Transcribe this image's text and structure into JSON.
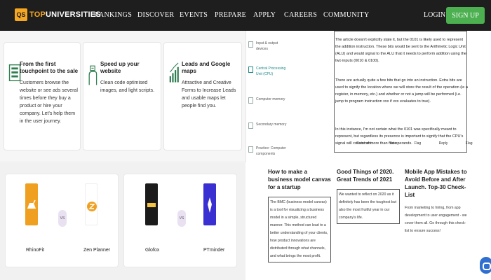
{
  "nav": {
    "logo_badge": "QS",
    "logo_top": "TOP",
    "logo_rest": "UNIVERSITIES",
    "items": [
      "RANKINGS",
      "DISCOVER",
      "EVENTS",
      "PREPARE",
      "APPLY",
      "CAREERS",
      "COMMUNITY"
    ],
    "login": "LOGIN",
    "signup": "SIGN UP"
  },
  "features": [
    {
      "title": "From the first touchpoint to the sale",
      "text": "Customers browse the website or see ads several times before they buy a product or hire your company. Let's help them in the user journey.",
      "icon": "touchpoint-icon"
    },
    {
      "title": "Speed up your website",
      "text": "Clean code optimised images, and light scripts.",
      "icon": "speed-hand-icon"
    },
    {
      "title": "Leads and Google maps",
      "text": "Attractive and Creative Forms to Increase Leads and usable maps let people find you.",
      "icon": "growth-chart-icon"
    }
  ],
  "comparisons": [
    {
      "left": "RhinoFit",
      "right": "Zen Planner",
      "vs": "VS"
    },
    {
      "left": "Glofox",
      "right": "PTminder",
      "vs": "VS"
    }
  ],
  "sidebar": {
    "items": [
      {
        "label": "Input & output devices",
        "active": false
      },
      {
        "label": "Central Processing Unit (CPU)",
        "active": true
      },
      {
        "label": "Computer memory",
        "active": false
      },
      {
        "label": "Secondary memory",
        "active": false
      },
      {
        "label": "Practice: Computer components",
        "active": false
      }
    ]
  },
  "doc": {
    "p1": "The article doesn't explicitly state it, but the 0101 is likely used to represent the addition instruction. These bits would be sent to the Arithmetic Logic Unit (ALU) and would signal to the ALU that it needs to perform addition using the two inputs (0010 & 0100).",
    "p2": "There are actually quite a few bits that go into an instruction. Extra bits are used to signify the location where we will store the result of the operation (ie a register, in memory, etc.) and whether or not a jump will be performed (i.e. jump to program instruction xxx if xxx evaluates to true).",
    "p3": "In this instance, I'm not certain what the 0101 was specifically meant to represent, but regardless its presence is important to signify that the CPU's signal will consist of more than the operands.",
    "actions": [
      "Comment",
      "Vote",
      "Flag",
      "Reply",
      "Flag"
    ]
  },
  "articles": [
    {
      "title": "How to make a business model canvas for a startup",
      "text": "The BMC (business model canvas) is a tool for visualizing a business model in a simple, structured manner. This method can lead to a better understanding of your clients, how product innovations are distributed through what channels, and what brings the most profit."
    },
    {
      "title": "Good Things of 2020. Great Trends of 2021",
      "text": "We wanted to reflect on 2020 as it definitely has been the toughest but also the most fruitful year in our company's life."
    },
    {
      "title": "Mobile App Mistakes to Avoid Before and After Launch. Top-30 Check-List",
      "text": "From marketing to hiring, from app development to user engagement - we cover them all. Go through this check-list to ensure success!"
    }
  ],
  "colors": {
    "nav_bg": "#1e1e1e",
    "accent": "#f5a623",
    "signup": "#4caf50",
    "teal": "#1f8a86",
    "chat": "#2f6fd1"
  }
}
